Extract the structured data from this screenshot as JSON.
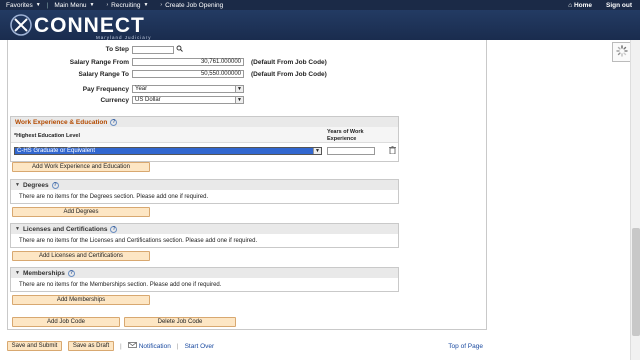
{
  "topnav": {
    "favorites": "Favorites",
    "main_menu": "Main Menu",
    "breadcrumb_1": "Recruiting",
    "breadcrumb_2": "Create Job Opening",
    "home": "Home",
    "sign_out": "Sign out"
  },
  "brand": {
    "name": "CONNECT",
    "subtitle": "Maryland Judiciary"
  },
  "form": {
    "to_step_label": "To Step",
    "to_step_value": "",
    "salary_from_label": "Salary Range From",
    "salary_from_value": "30,761.000000",
    "salary_from_note": "(Default From Job Code)",
    "salary_to_label": "Salary Range To",
    "salary_to_value": "50,550.000000",
    "salary_to_note": "(Default From Job Code)",
    "pay_freq_label": "Pay Frequency",
    "pay_freq_value": "Year",
    "currency_label": "Currency",
    "currency_value": "US Dollar"
  },
  "work_exp": {
    "title": "Work Experience & Education",
    "col_education": "*Highest Education Level",
    "col_years": "Years of Work Experience",
    "education_value": "C-HS Graduate or Equivalent",
    "years_value": "",
    "add_button": "Add Work Experience and Education"
  },
  "degrees": {
    "title": "Degrees",
    "message": "There are no items for the Degrees section.  Please add one if required.",
    "add_button": "Add Degrees"
  },
  "licenses": {
    "title": "Licenses and Certifications",
    "message": "There are no items for the Licenses and Certifications section.  Please add one if required.",
    "add_button": "Add Licenses and Certifications"
  },
  "memberships": {
    "title": "Memberships",
    "message": "There are no items for the Memberships section.  Please add one if required.",
    "add_button": "Add Memberships"
  },
  "job_code": {
    "add": "Add Job Code",
    "delete": "Delete Job Code"
  },
  "bottom": {
    "save_submit": "Save and Submit",
    "save_draft": "Save as Draft",
    "notification": "Notification",
    "start_over": "Start Over",
    "top_of_page": "Top of Page"
  },
  "colors": {
    "nav": "#1b2a47",
    "brand": "#233b63",
    "button": "#fde6c4",
    "section_title": "#b34a00"
  }
}
